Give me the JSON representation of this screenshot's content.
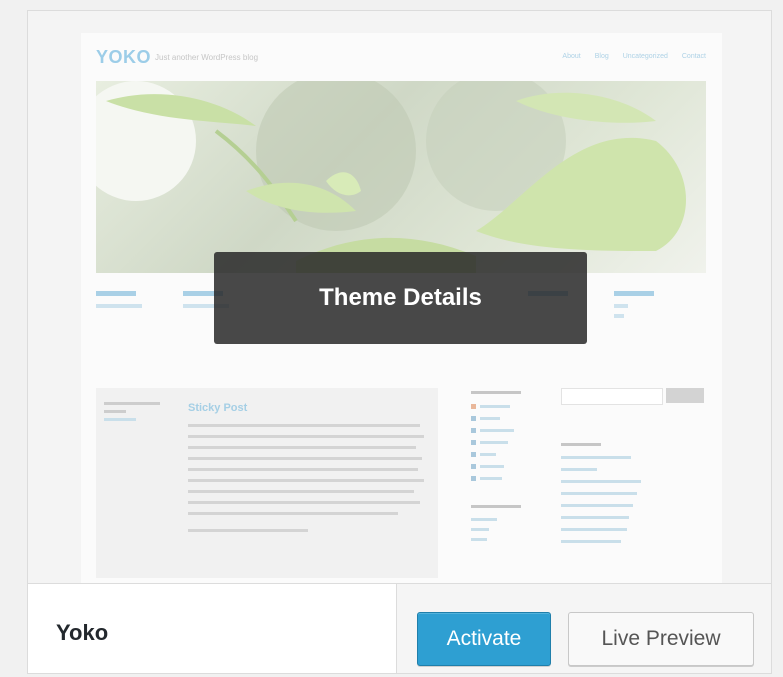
{
  "preview": {
    "logo": "YOKO",
    "tagline": "Just another WordPress blog",
    "nav": [
      "About",
      "Blog",
      "Uncategorized",
      "Contact"
    ],
    "post_title": "Sticky Post"
  },
  "overlay": {
    "label": "Theme Details"
  },
  "footer": {
    "theme_name": "Yoko",
    "activate_label": "Activate",
    "live_preview_label": "Live Preview"
  },
  "colors": {
    "primary_button": "#2e9fd2",
    "overlay": "#282828"
  }
}
